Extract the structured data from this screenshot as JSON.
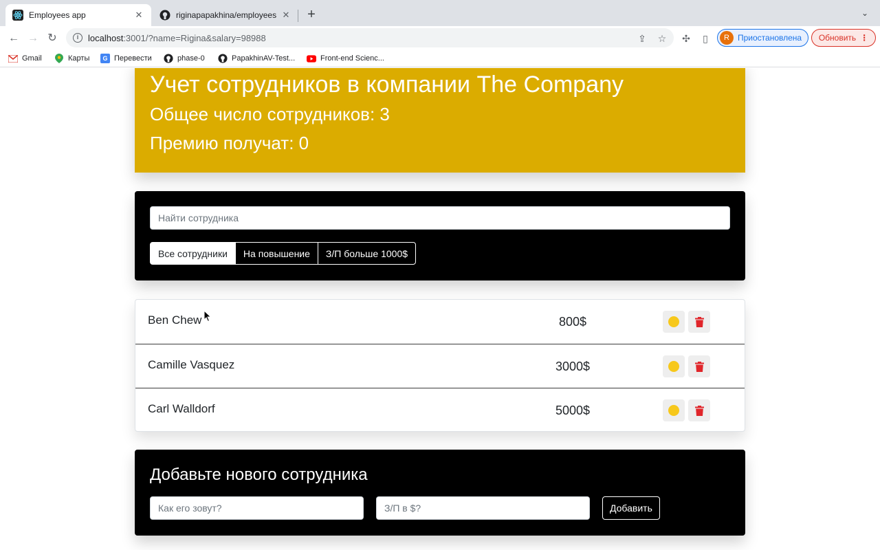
{
  "browser": {
    "tabs": [
      {
        "title": "Employees app",
        "favicon": "react-icon"
      },
      {
        "title": "riginapapakhina/employees",
        "favicon": "github-icon"
      }
    ],
    "url_host": "localhost",
    "url_path": ":3001/?name=Rigina&salary=98988",
    "profile": {
      "initial": "R",
      "status": "Приостановлена"
    },
    "update_label": "Обновить",
    "bookmarks": [
      {
        "label": "Gmail",
        "icon": "gmail-icon"
      },
      {
        "label": "Карты",
        "icon": "maps-icon"
      },
      {
        "label": "Перевести",
        "icon": "translate-icon"
      },
      {
        "label": "phase-0",
        "icon": "github-icon"
      },
      {
        "label": "PapakhinAV-Test...",
        "icon": "github-icon"
      },
      {
        "label": "Front-end Scienc...",
        "icon": "youtube-icon"
      }
    ]
  },
  "app_info": {
    "title": "Учет сотрудников в компании The Company",
    "total_line": "Общее число сотрудников: 3",
    "bonus_line": "Премию получат: 0"
  },
  "search": {
    "placeholder": "Найти сотрудника",
    "filters": [
      "Все сотрудники",
      "На повышение",
      "З/П больше 1000$"
    ],
    "active_filter": "Все сотрудники"
  },
  "employees": [
    {
      "name": "Ben Chew",
      "salary": "800$"
    },
    {
      "name": "Camille Vasquez",
      "salary": "3000$"
    },
    {
      "name": "Carl Walldorf",
      "salary": "5000$"
    }
  ],
  "add_form": {
    "title": "Добавьте нового сотрудника",
    "name_placeholder": "Как его зовут?",
    "salary_placeholder": "З/П в $?",
    "submit_label": "Добавить"
  },
  "colors": {
    "app_info_bg": "#dbac00",
    "panel_bg": "#000000",
    "cookie": "#f7c81b",
    "trash": "#e0262b"
  }
}
